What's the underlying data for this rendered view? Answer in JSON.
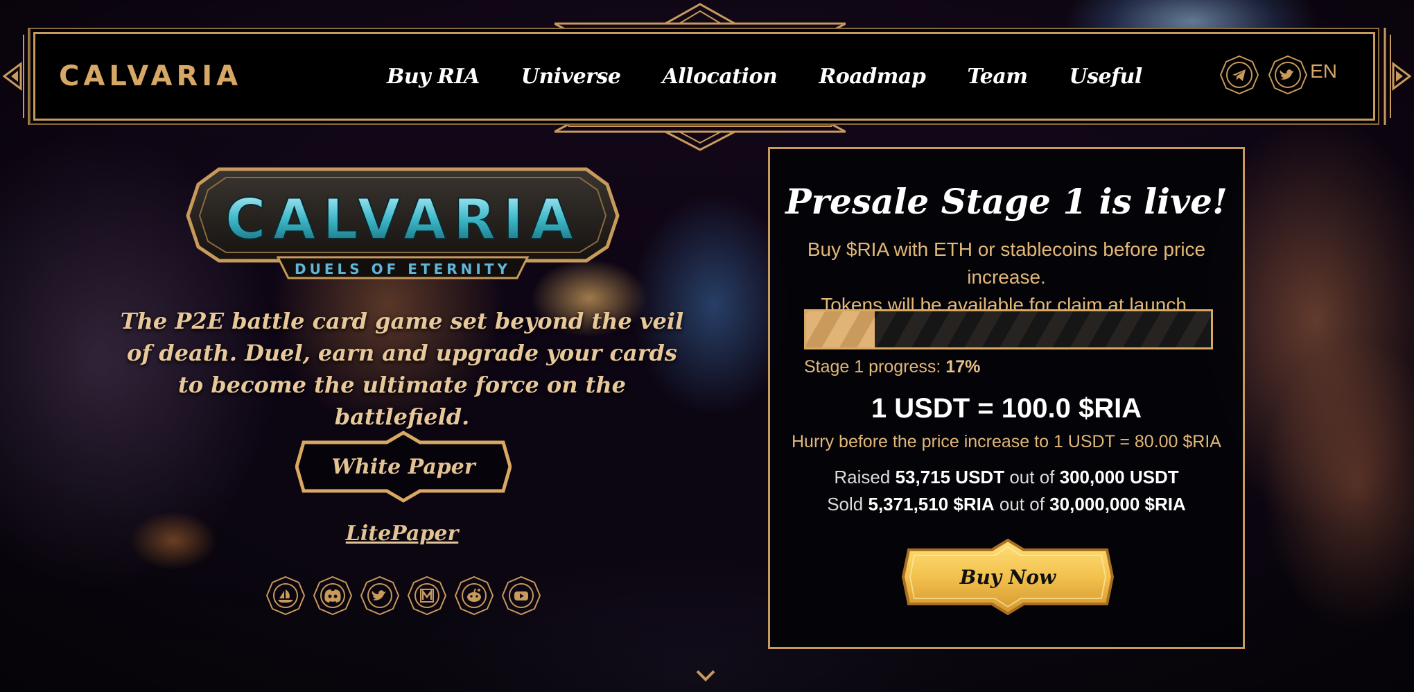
{
  "header": {
    "logo": "CALVARIA",
    "nav": [
      "Buy RIA",
      "Universe",
      "Allocation",
      "Roadmap",
      "Team",
      "Useful"
    ],
    "social_icons": [
      "telegram-icon",
      "twitter-icon"
    ],
    "language": "EN"
  },
  "hero": {
    "logo_title": "CALVARIA",
    "logo_subtitle": "DUELS OF ETERNITY",
    "description": "The P2E battle card game set beyond the veil of death. Duel, earn and upgrade your cards to become the ultimate force on the battlefield.",
    "white_paper_label": "White Paper",
    "litepaper_label": "LitePaper",
    "social_icons": [
      "opensea-icon",
      "discord-icon",
      "twitter-icon",
      "medium-icon",
      "reddit-icon",
      "youtube-icon"
    ]
  },
  "presale": {
    "title": "Presale Stage 1 is live!",
    "subtitle_line1": "Buy $RIA with ETH or stablecoins before price increase.",
    "subtitle_line2": "Tokens will be available for claim at launch.",
    "progress_label": "Stage 1 progress:",
    "progress_value": "17%",
    "progress_fraction": 0.17,
    "rate": "1 USDT = 100.0 $RIA",
    "hurry": "Hurry before the price increase to 1 USDT = 80.00 $RIA",
    "raised_prefix": "Raised",
    "raised_amount": "53,715 USDT",
    "raised_mid": "out of",
    "raised_total": "300,000 USDT",
    "sold_prefix": "Sold",
    "sold_amount": "5,371,510 $RIA",
    "sold_mid": "out of",
    "sold_total": "30,000,000 $RIA",
    "buy_label": "Buy Now"
  },
  "colors": {
    "gold": "#c89a5c",
    "text_gold": "#e2b878",
    "button_gold": "#f2c14e"
  }
}
